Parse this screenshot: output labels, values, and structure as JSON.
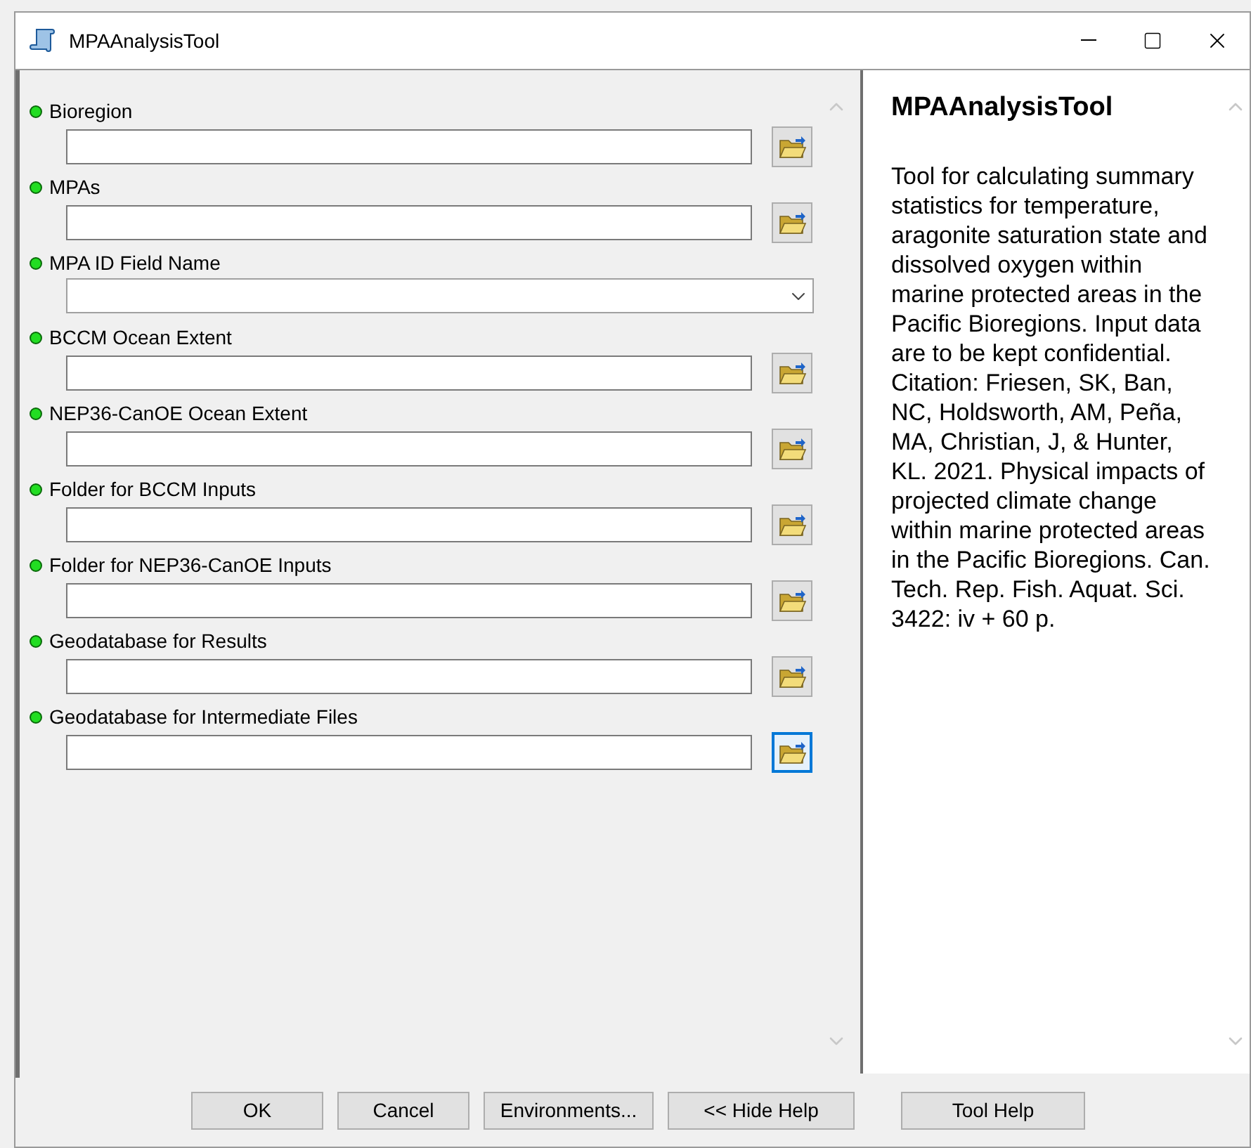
{
  "window": {
    "title": "MPAAnalysisTool"
  },
  "parameters": [
    {
      "label": "Bioregion",
      "kind": "browse",
      "focused": false
    },
    {
      "label": "MPAs",
      "kind": "browse",
      "focused": false
    },
    {
      "label": "MPA ID Field Name",
      "kind": "dropdown",
      "focused": false
    },
    {
      "label": "BCCM Ocean Extent",
      "kind": "browse",
      "focused": false
    },
    {
      "label": "NEP36-CanOE Ocean Extent",
      "kind": "browse",
      "focused": false
    },
    {
      "label": "Folder for BCCM Inputs",
      "kind": "browse",
      "focused": false
    },
    {
      "label": "Folder for NEP36-CanOE Inputs",
      "kind": "browse",
      "focused": false
    },
    {
      "label": "Geodatabase for Results",
      "kind": "browse",
      "focused": false
    },
    {
      "label": "Geodatabase for Intermediate Files",
      "kind": "browse",
      "focused": true
    }
  ],
  "help": {
    "title": "MPAAnalysisTool",
    "text": "Tool for calculating summary statistics for temperature, aragonite saturation state and dissolved oxygen within marine protected areas in the Pacific Bioregions. Input data are to be kept confidential. Citation: Friesen, SK, Ban, NC, Holdsworth, AM, Peña, MA, Christian, J, & Hunter, KL. 2021. Physical impacts of projected climate change within marine protected areas in the Pacific Bioregions. Can. Tech. Rep. Fish. Aquat. Sci. 3422: iv + 60 p."
  },
  "buttons": [
    "OK",
    "Cancel",
    "Environments...",
    "<< Hide Help",
    "Tool Help"
  ]
}
